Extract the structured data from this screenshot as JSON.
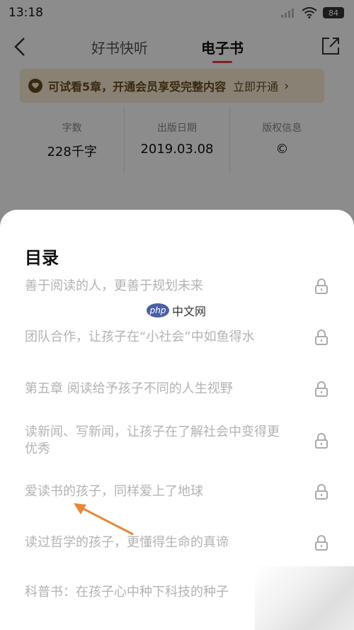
{
  "status": {
    "time": "13:18",
    "battery": "84"
  },
  "nav": {
    "tabs": [
      "好书快听",
      "电子书"
    ]
  },
  "banner": {
    "text": "可试看5章，开通会员享受完整内容",
    "link": "立即开通"
  },
  "info": [
    {
      "label": "字数",
      "value": "228千字"
    },
    {
      "label": "出版日期",
      "value": "2019.03.08"
    },
    {
      "label": "版权信息",
      "value": "©"
    }
  ],
  "toc": {
    "title": "目录",
    "items": [
      "善于阅读的人，更善于规划未来",
      "团队合作，让孩子在“小社会”中如鱼得水",
      "第五章 阅读给予孩子不同的人生视野",
      "读新闻、写新闻，让孩子在了解社会中变得更优秀",
      "爱读书的孩子，同样爱上了地球",
      "读过哲学的孩子，更懂得生命的真谛",
      "科普书：在孩子心中种下科技的种子"
    ]
  },
  "watermark": {
    "logo": "php",
    "text": "中文网"
  },
  "colors": {
    "accent": "#e83b4b",
    "banner_bg": "#f8ecd3",
    "banner_text": "#6b4c1e",
    "arrow": "#e8873a"
  }
}
